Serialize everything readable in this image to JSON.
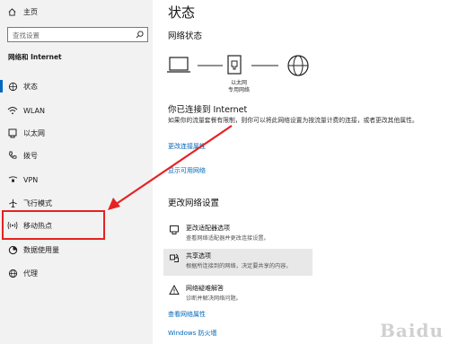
{
  "sidebar": {
    "home_label": "主页",
    "search_placeholder": "查找设置",
    "section_title": "网络和 Internet",
    "items": [
      {
        "label": "状态",
        "icon": "globe-status-icon"
      },
      {
        "label": "WLAN",
        "icon": "wifi-icon"
      },
      {
        "label": "以太网",
        "icon": "ethernet-icon"
      },
      {
        "label": "拨号",
        "icon": "phone-icon"
      },
      {
        "label": "VPN",
        "icon": "vpn-icon"
      },
      {
        "label": "飞行模式",
        "icon": "airplane-icon"
      },
      {
        "label": "移动热点",
        "icon": "hotspot-icon"
      },
      {
        "label": "数据使用量",
        "icon": "data-usage-icon"
      },
      {
        "label": "代理",
        "icon": "globe-icon"
      }
    ]
  },
  "main": {
    "title": "状态",
    "network_status_heading": "网络状态",
    "ethernet_label_line1": "以太网",
    "ethernet_label_line2": "专用网络",
    "connected_heading": "你已连接到 Internet",
    "description": "如果你的流量套餐有限制，则你可以将此网络设置为按流量计费的连接，或者更改其他属性。",
    "link_change_properties": "更改连接属性",
    "link_show_networks": "显示可用网络",
    "change_settings_heading": "更改网络设置",
    "options": [
      {
        "title": "更改适配器选项",
        "desc": "查看网络适配器并更改连接设置。"
      },
      {
        "title": "共享选项",
        "desc": "根据所连接到的网络，决定要共享的内容。"
      },
      {
        "title": "网络疑难解答",
        "desc": "诊断并解决网络问题。"
      }
    ],
    "link_view_properties": "查看网络属性",
    "link_firewall": "Windows 防火墙"
  },
  "watermark": "Baidu",
  "colors": {
    "accent": "#0067c0",
    "link": "#0067b8",
    "annotation_red": "#e52222"
  }
}
